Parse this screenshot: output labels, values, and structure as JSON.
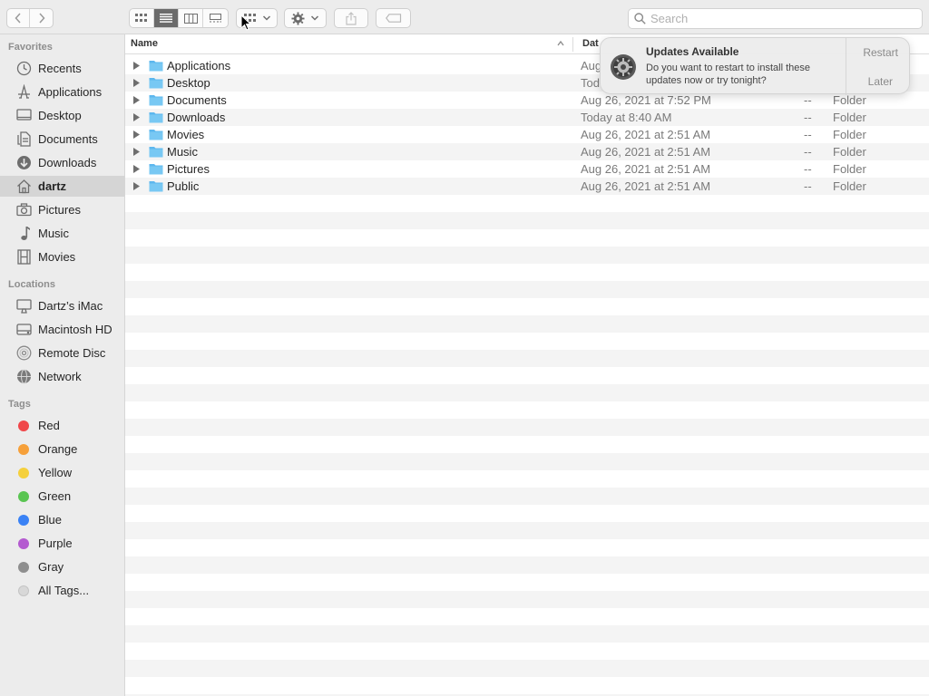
{
  "toolbar": {
    "search_placeholder": "Search",
    "view_buttons": [
      "icon-view",
      "list-view",
      "column-view",
      "gallery-view"
    ],
    "active_view": "list-view"
  },
  "sidebar": {
    "favorites_title": "Favorites",
    "favorites": [
      {
        "label": "Recents",
        "icon": "clock-icon"
      },
      {
        "label": "Applications",
        "icon": "applications-icon"
      },
      {
        "label": "Desktop",
        "icon": "desktop-icon"
      },
      {
        "label": "Documents",
        "icon": "document-icon"
      },
      {
        "label": "Downloads",
        "icon": "download-icon"
      },
      {
        "label": "dartz",
        "icon": "home-icon",
        "selected": true
      },
      {
        "label": "Pictures",
        "icon": "camera-icon"
      },
      {
        "label": "Music",
        "icon": "music-note-icon"
      },
      {
        "label": "Movies",
        "icon": "film-icon"
      }
    ],
    "locations_title": "Locations",
    "locations": [
      {
        "label": "Dartz’s iMac",
        "icon": "imac-icon"
      },
      {
        "label": "Macintosh HD",
        "icon": "hard-drive-icon"
      },
      {
        "label": "Remote Disc",
        "icon": "disc-icon"
      },
      {
        "label": "Network",
        "icon": "globe-icon"
      }
    ],
    "tags_title": "Tags",
    "tags": [
      {
        "label": "Red",
        "color": "#f0474a"
      },
      {
        "label": "Orange",
        "color": "#f6a03a"
      },
      {
        "label": "Yellow",
        "color": "#f5d03c"
      },
      {
        "label": "Green",
        "color": "#5ac552"
      },
      {
        "label": "Blue",
        "color": "#3a82f5"
      },
      {
        "label": "Purple",
        "color": "#b45ad0"
      },
      {
        "label": "Gray",
        "color": "#8e8e8e"
      },
      {
        "label": "All Tags...",
        "color": "#d8d8d8"
      }
    ]
  },
  "columns": {
    "name": "Name",
    "date": "Dat"
  },
  "files": [
    {
      "name": "Applications",
      "date": "Aug",
      "size": "",
      "kind": ""
    },
    {
      "name": "Desktop",
      "date": "Tod",
      "size": "",
      "kind": ""
    },
    {
      "name": "Documents",
      "date": "Aug 26, 2021 at 7:52 PM",
      "size": "--",
      "kind": "Folder"
    },
    {
      "name": "Downloads",
      "date": "Today at 8:40 AM",
      "size": "--",
      "kind": "Folder"
    },
    {
      "name": "Movies",
      "date": "Aug 26, 2021 at 2:51 AM",
      "size": "--",
      "kind": "Folder"
    },
    {
      "name": "Music",
      "date": "Aug 26, 2021 at 2:51 AM",
      "size": "--",
      "kind": "Folder"
    },
    {
      "name": "Pictures",
      "date": "Aug 26, 2021 at 2:51 AM",
      "size": "--",
      "kind": "Folder"
    },
    {
      "name": "Public",
      "date": "Aug 26, 2021 at 2:51 AM",
      "size": "--",
      "kind": "Folder"
    }
  ],
  "notification": {
    "title": "Updates Available",
    "body": "Do you want to restart to install these updates now or try tonight?",
    "restart_label": "Restart",
    "later_label": "Later"
  },
  "colors": {
    "folder": "#5db7ee",
    "selection": "#d5d5d5"
  }
}
